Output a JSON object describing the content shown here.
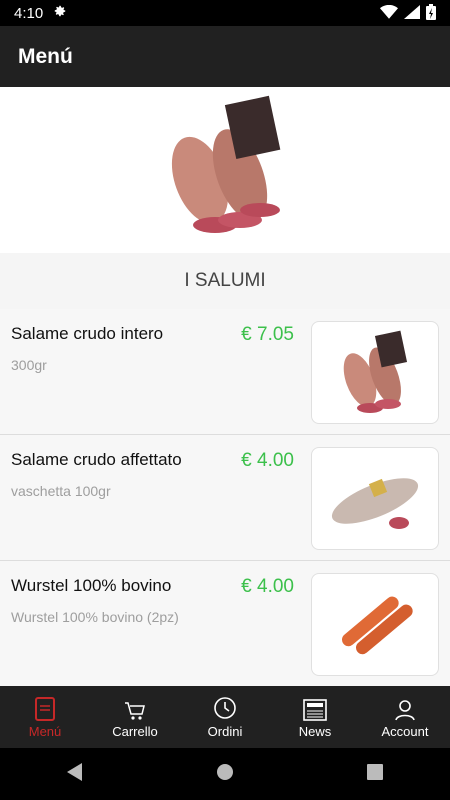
{
  "status": {
    "time": "4:10"
  },
  "appbar": {
    "title": "Menú"
  },
  "section": {
    "title": "I SALUMI"
  },
  "products": [
    {
      "name": "Salame crudo intero",
      "desc": "300gr",
      "price": "€ 7.05",
      "image": "salame-intero-image"
    },
    {
      "name": "Salame crudo affettato",
      "desc": "vaschetta 100gr",
      "price": "€ 4.00",
      "image": "salame-affettato-image"
    },
    {
      "name": "Wurstel 100% bovino",
      "desc": "Wurstel 100% bovino (2pz)",
      "price": "€ 4.00",
      "image": "wurstel-image"
    }
  ],
  "nav": {
    "menu": "Menú",
    "cart": "Carrello",
    "orders": "Ordini",
    "news": "News",
    "account": "Account"
  },
  "colors": {
    "price": "#3cc04b",
    "active_tab": "#c62828",
    "bar": "#212121"
  }
}
